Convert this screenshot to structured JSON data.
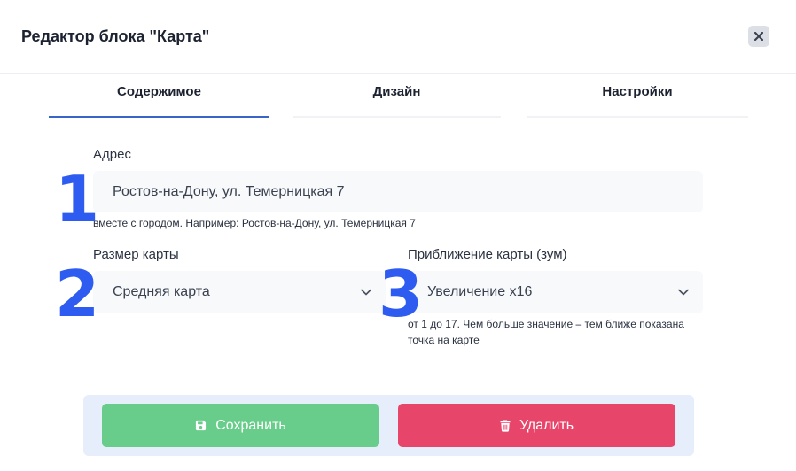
{
  "modal": {
    "title": "Редактор блока \"Карта\""
  },
  "tabs": [
    {
      "label": "Содержимое",
      "active": true
    },
    {
      "label": "Дизайн",
      "active": false
    },
    {
      "label": "Настройки",
      "active": false
    }
  ],
  "address": {
    "label": "Адрес",
    "value": "Ростов-на-Дону, ул. Темерницкая 7",
    "hint": "вместе с городом. Например: Ростов-на-Дону, ул. Темерницкая 7"
  },
  "map_size": {
    "label": "Размер карты",
    "selected": "Средняя карта"
  },
  "zoom": {
    "label": "Приближение карты (зум)",
    "selected": "Увеличение x16",
    "hint": "от 1 до 17. Чем больше значение – тем ближе показана точка на карте"
  },
  "annotations": [
    "1",
    "2",
    "3"
  ],
  "footer": {
    "save_label": "Сохранить",
    "delete_label": "Удалить"
  },
  "colors": {
    "accent": "#3b64c8",
    "annotation": "#2f5cf0",
    "save": "#68cd8a",
    "delete": "#e8456b",
    "footer_bg": "#e7eefb"
  },
  "icons": {
    "close": "close-icon",
    "chevron": "chevron-down-icon",
    "save": "floppy-disk-icon",
    "delete": "trash-icon"
  }
}
